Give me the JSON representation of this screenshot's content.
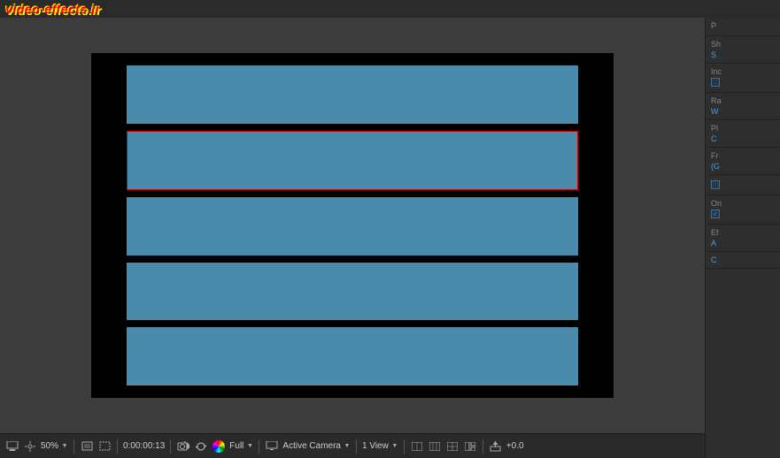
{
  "watermark": {
    "text": "video-effects.ir"
  },
  "preview": {
    "stripes": [
      {
        "id": 1,
        "highlighted": false
      },
      {
        "id": 2,
        "highlighted": true
      },
      {
        "id": 3,
        "highlighted": false
      },
      {
        "id": 4,
        "highlighted": false
      },
      {
        "id": 5,
        "highlighted": false
      }
    ]
  },
  "bottom_toolbar": {
    "zoom": "50%",
    "timecode": "0:00:00:13",
    "quality": "Full",
    "active_camera": "Active Camera",
    "view": "1 View",
    "offset": "+0.0"
  },
  "right_panel": {
    "sections": [
      {
        "label": "Sh",
        "value": "S"
      },
      {
        "label": "Inc",
        "checkbox": false
      },
      {
        "label": "Ra",
        "value": "W"
      },
      {
        "label": "Pl",
        "value": "C"
      },
      {
        "label": "Fr",
        "value": "(G"
      },
      {
        "label": "",
        "checkbox": false
      },
      {
        "label": "On",
        "checkbox": true
      },
      {
        "label": "Ef",
        "value": "A"
      },
      {
        "label": "",
        "value": "C"
      }
    ]
  }
}
